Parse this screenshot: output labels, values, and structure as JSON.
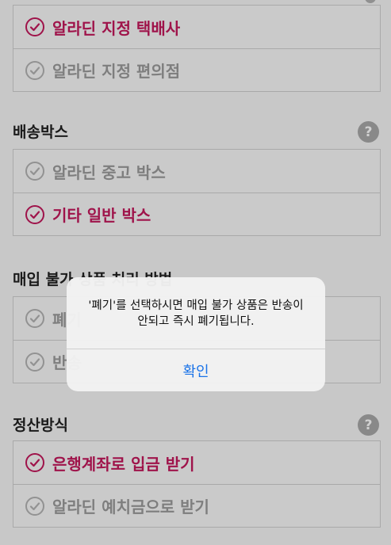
{
  "carrier_group": {
    "options": [
      {
        "label": "알라딘 지정 택배사",
        "selected": true
      },
      {
        "label": "알라딘 지정 편의점",
        "selected": false
      }
    ]
  },
  "box_section": {
    "title": "배송박스",
    "help": "?",
    "options": [
      {
        "label": "알라딘 중고 박스",
        "selected": false
      },
      {
        "label": "기타 일반 박스",
        "selected": true
      }
    ]
  },
  "unpurchasable_section": {
    "title": "매입 불가 상품 처리 방법",
    "options": [
      {
        "label": "폐기",
        "selected": false
      },
      {
        "label": "반송",
        "selected": false
      }
    ]
  },
  "settlement_section": {
    "title": "정산방식",
    "help": "?",
    "options": [
      {
        "label": "은행계좌로 입금 받기",
        "selected": true
      },
      {
        "label": "알라딘 예치금으로 받기",
        "selected": false
      }
    ]
  },
  "alert": {
    "line1": "'폐기'를 선택하시면 매입 불가 상품은 반송이",
    "line2": "안되고 즉시 폐기됩니다.",
    "confirm_label": "확인"
  },
  "colors": {
    "accent": "#c2185b",
    "link_blue": "#1a73e8",
    "unselected": "#9a9a9a"
  }
}
